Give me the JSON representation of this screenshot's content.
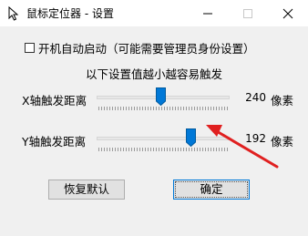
{
  "window": {
    "title": "鼠标定位器 - 设置"
  },
  "settings": {
    "autostart_label": "开机自动启动（可能需要管理员身份设置）",
    "autostart_checked": false,
    "hint": "以下设置值越小越容易触发",
    "x_distance": {
      "label": "X轴触发距离",
      "value": "240",
      "unit": "像素",
      "level": 0.48
    },
    "y_distance": {
      "label": "Y轴触发距离",
      "value": "192",
      "unit": "像素",
      "level": 0.72
    }
  },
  "buttons": {
    "reset_label": "恢复默认",
    "ok_label": "确定"
  },
  "colors": {
    "thumb": "#0078d7",
    "annotation_arrow": "#e02020"
  }
}
